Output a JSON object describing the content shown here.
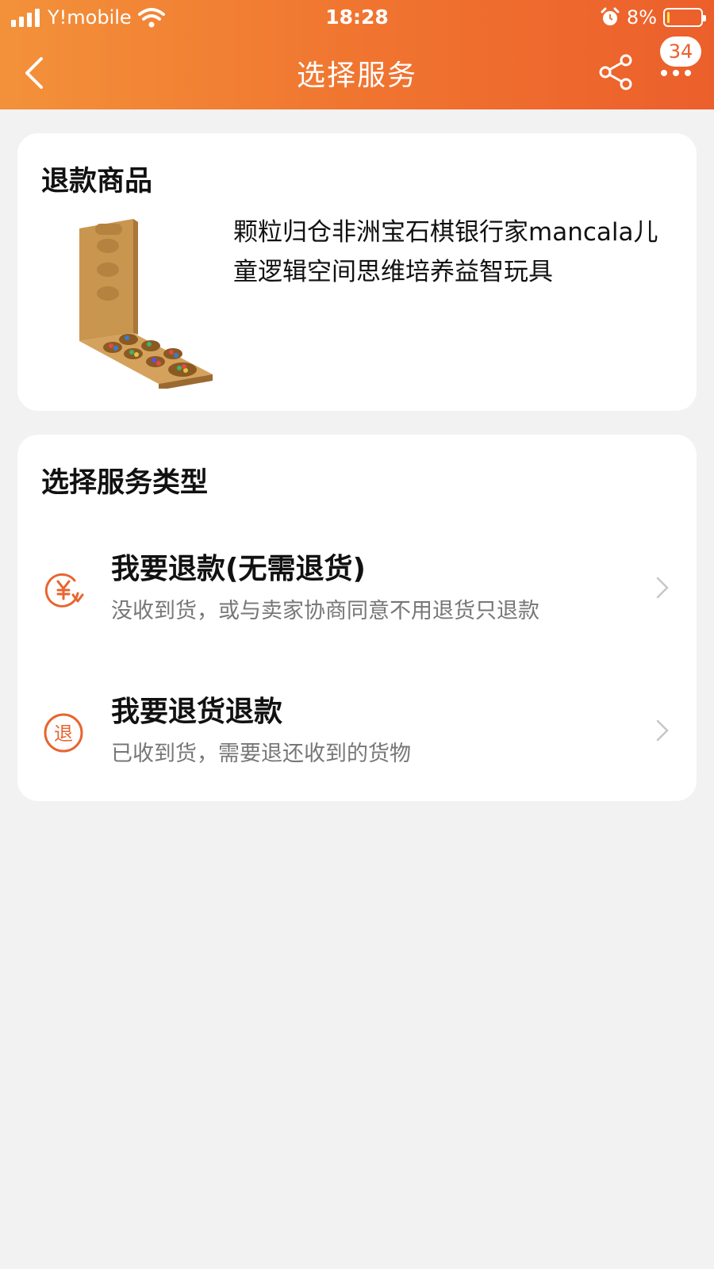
{
  "status_bar": {
    "carrier": "Y!mobile",
    "time": "18:28",
    "battery_percent": "8%",
    "battery_level": 0.08
  },
  "nav": {
    "title": "选择服务",
    "badge": "34"
  },
  "product_card": {
    "title": "退款商品",
    "product_name": "颗粒归仓非洲宝石棋银行家mancala儿童逻辑空间思维培养益智玩具"
  },
  "service_card": {
    "title": "选择服务类型",
    "options": [
      {
        "title": "我要退款(无需退货)",
        "desc": "没收到货，或与卖家协商同意不用退货只退款",
        "icon": "refund-yen-icon"
      },
      {
        "title": "我要退货退款",
        "desc": "已收到货，需要退还收到的货物",
        "icon": "return-tui-icon",
        "icon_char": "退"
      }
    ]
  },
  "colors": {
    "accent": "#f07530",
    "header_start": "#f3913a",
    "header_end": "#ec5f2b",
    "icon": "#e8652f"
  }
}
